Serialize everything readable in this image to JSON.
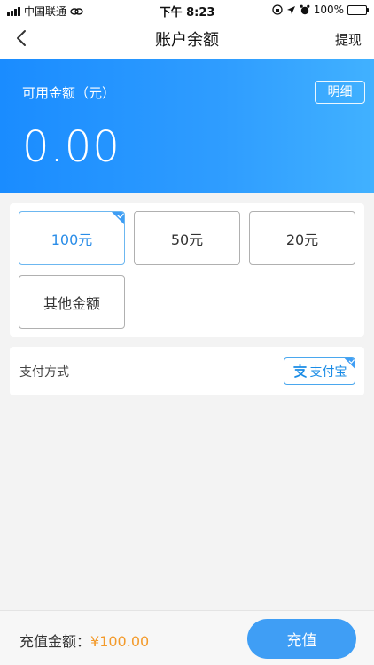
{
  "status_bar": {
    "carrier": "中国联通",
    "time": "下午 8:23",
    "battery": "100%"
  },
  "nav": {
    "title": "账户余额",
    "right_action": "提现"
  },
  "balance": {
    "label": "可用金额（元）",
    "amount": "0.00",
    "detail_button": "明细"
  },
  "amount_options": [
    {
      "label": "100元",
      "selected": true
    },
    {
      "label": "50元",
      "selected": false
    },
    {
      "label": "20元",
      "selected": false
    },
    {
      "label": "其他金额",
      "selected": false
    }
  ],
  "payment": {
    "label": "支付方式",
    "method": "支付宝",
    "icon": "alipay-icon"
  },
  "footer": {
    "total_label": "充值金额：",
    "total_value": "¥100.00",
    "recharge_button": "充值"
  },
  "colors": {
    "primary": "#2f9dff",
    "accent_orange": "#f39a2a",
    "button_blue": "#3f9ef5"
  }
}
